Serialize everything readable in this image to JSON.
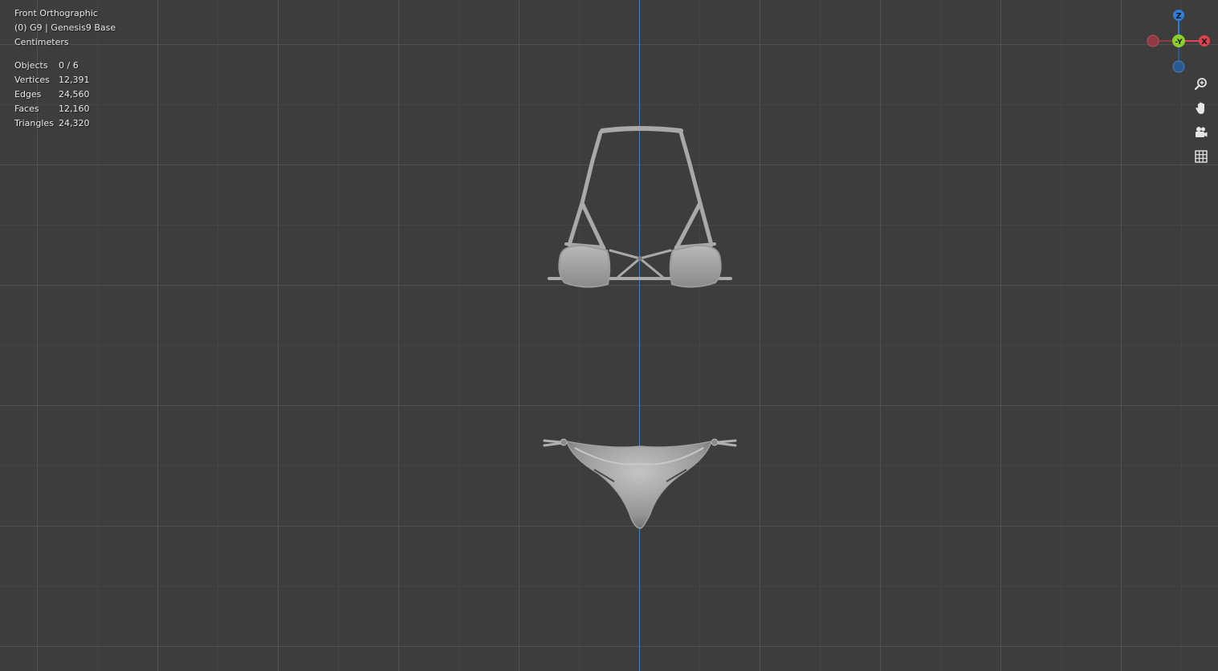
{
  "viewport": {
    "view_name": "Front Orthographic",
    "collection_info": "(0) G9 | Genesis9 Base",
    "units": "Centimeters"
  },
  "stats": [
    {
      "label": "Objects",
      "value": "0 / 6"
    },
    {
      "label": "Vertices",
      "value": "12,391"
    },
    {
      "label": "Edges",
      "value": "24,560"
    },
    {
      "label": "Faces",
      "value": "12,160"
    },
    {
      "label": "Triangles",
      "value": "24,320"
    }
  ],
  "gizmo": {
    "z_label": "Z",
    "y_label": "-Y",
    "x_label": "X",
    "colors": {
      "z": "#2f7fd8",
      "y": "#8ccf2a",
      "x": "#e0434f",
      "neg_x": "#8e3a42",
      "neg_z": "#2a5a90"
    }
  },
  "nav_tools": [
    {
      "name": "zoom-icon"
    },
    {
      "name": "hand-pan-icon"
    },
    {
      "name": "camera-icon"
    },
    {
      "name": "grid-ortho-icon"
    }
  ]
}
